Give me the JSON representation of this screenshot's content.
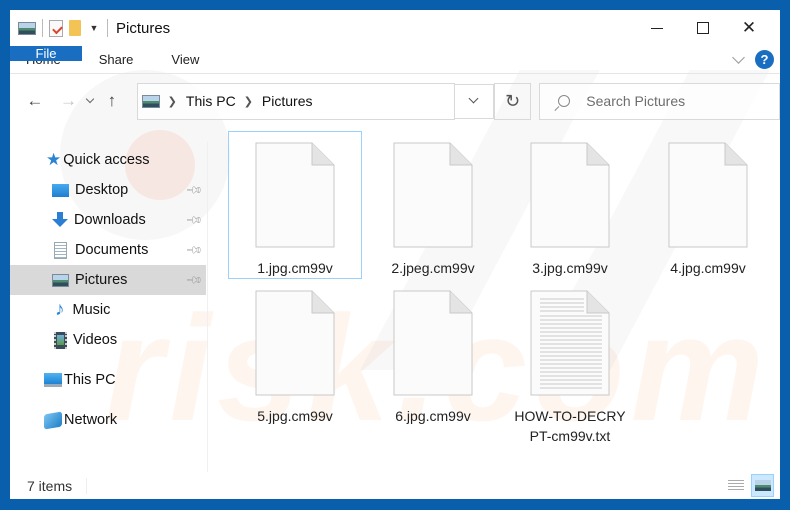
{
  "window": {
    "title": "Pictures",
    "controls": {
      "minimize": "minimize",
      "maximize": "maximize",
      "close": "close"
    }
  },
  "quick_access_toolbar": {
    "icons": [
      "pictures-icon",
      "properties-icon",
      "new-folder-icon",
      "customize-dropdown-icon"
    ]
  },
  "ribbon": {
    "tabs": [
      {
        "label": "File",
        "active": true
      },
      {
        "label": "Home"
      },
      {
        "label": "Share"
      },
      {
        "label": "View"
      }
    ],
    "help_label": "?"
  },
  "navigation": {
    "back": "←",
    "forward": "→",
    "recent": "⌄",
    "up": "↑",
    "breadcrumb": [
      "This PC",
      "Pictures"
    ],
    "refresh": "↻",
    "search_placeholder": "Search Pictures"
  },
  "sidebar": {
    "quick_access": {
      "label": "Quick access",
      "icon": "star-icon"
    },
    "items": [
      {
        "label": "Desktop",
        "icon": "desktop-icon",
        "pinned": true
      },
      {
        "label": "Downloads",
        "icon": "downloads-icon",
        "pinned": true
      },
      {
        "label": "Documents",
        "icon": "documents-icon",
        "pinned": true
      },
      {
        "label": "Pictures",
        "icon": "pictures-icon",
        "pinned": true,
        "selected": true
      },
      {
        "label": "Music",
        "icon": "music-icon"
      },
      {
        "label": "Videos",
        "icon": "videos-icon"
      }
    ],
    "this_pc": {
      "label": "This PC",
      "icon": "computer-icon"
    },
    "network": {
      "label": "Network",
      "icon": "network-icon"
    }
  },
  "files": [
    {
      "name": "1.jpg.cm99v",
      "type": "blank",
      "focused": true
    },
    {
      "name": "2.jpeg.cm99v",
      "type": "blank"
    },
    {
      "name": "3.jpg.cm99v",
      "type": "blank"
    },
    {
      "name": "4.jpg.cm99v",
      "type": "blank"
    },
    {
      "name": "5.jpg.cm99v",
      "type": "blank"
    },
    {
      "name": "6.jpg.cm99v",
      "type": "blank"
    },
    {
      "name": "HOW-TO-DECRYPT-cm99v.txt",
      "name_line1": "HOW-TO-DECRY",
      "name_line2": "PT-cm99v.txt",
      "type": "text"
    }
  ],
  "status": {
    "item_count": "7 items",
    "views": [
      {
        "name": "details-view"
      },
      {
        "name": "large-icons-view",
        "active": true
      }
    ]
  },
  "watermark": "risk.com",
  "colors": {
    "frame": "#0a5fad",
    "file_tab": "#1a6ec2",
    "selected_sidebar": "#d9d9d9",
    "focus_outline": "#99d1ff"
  }
}
